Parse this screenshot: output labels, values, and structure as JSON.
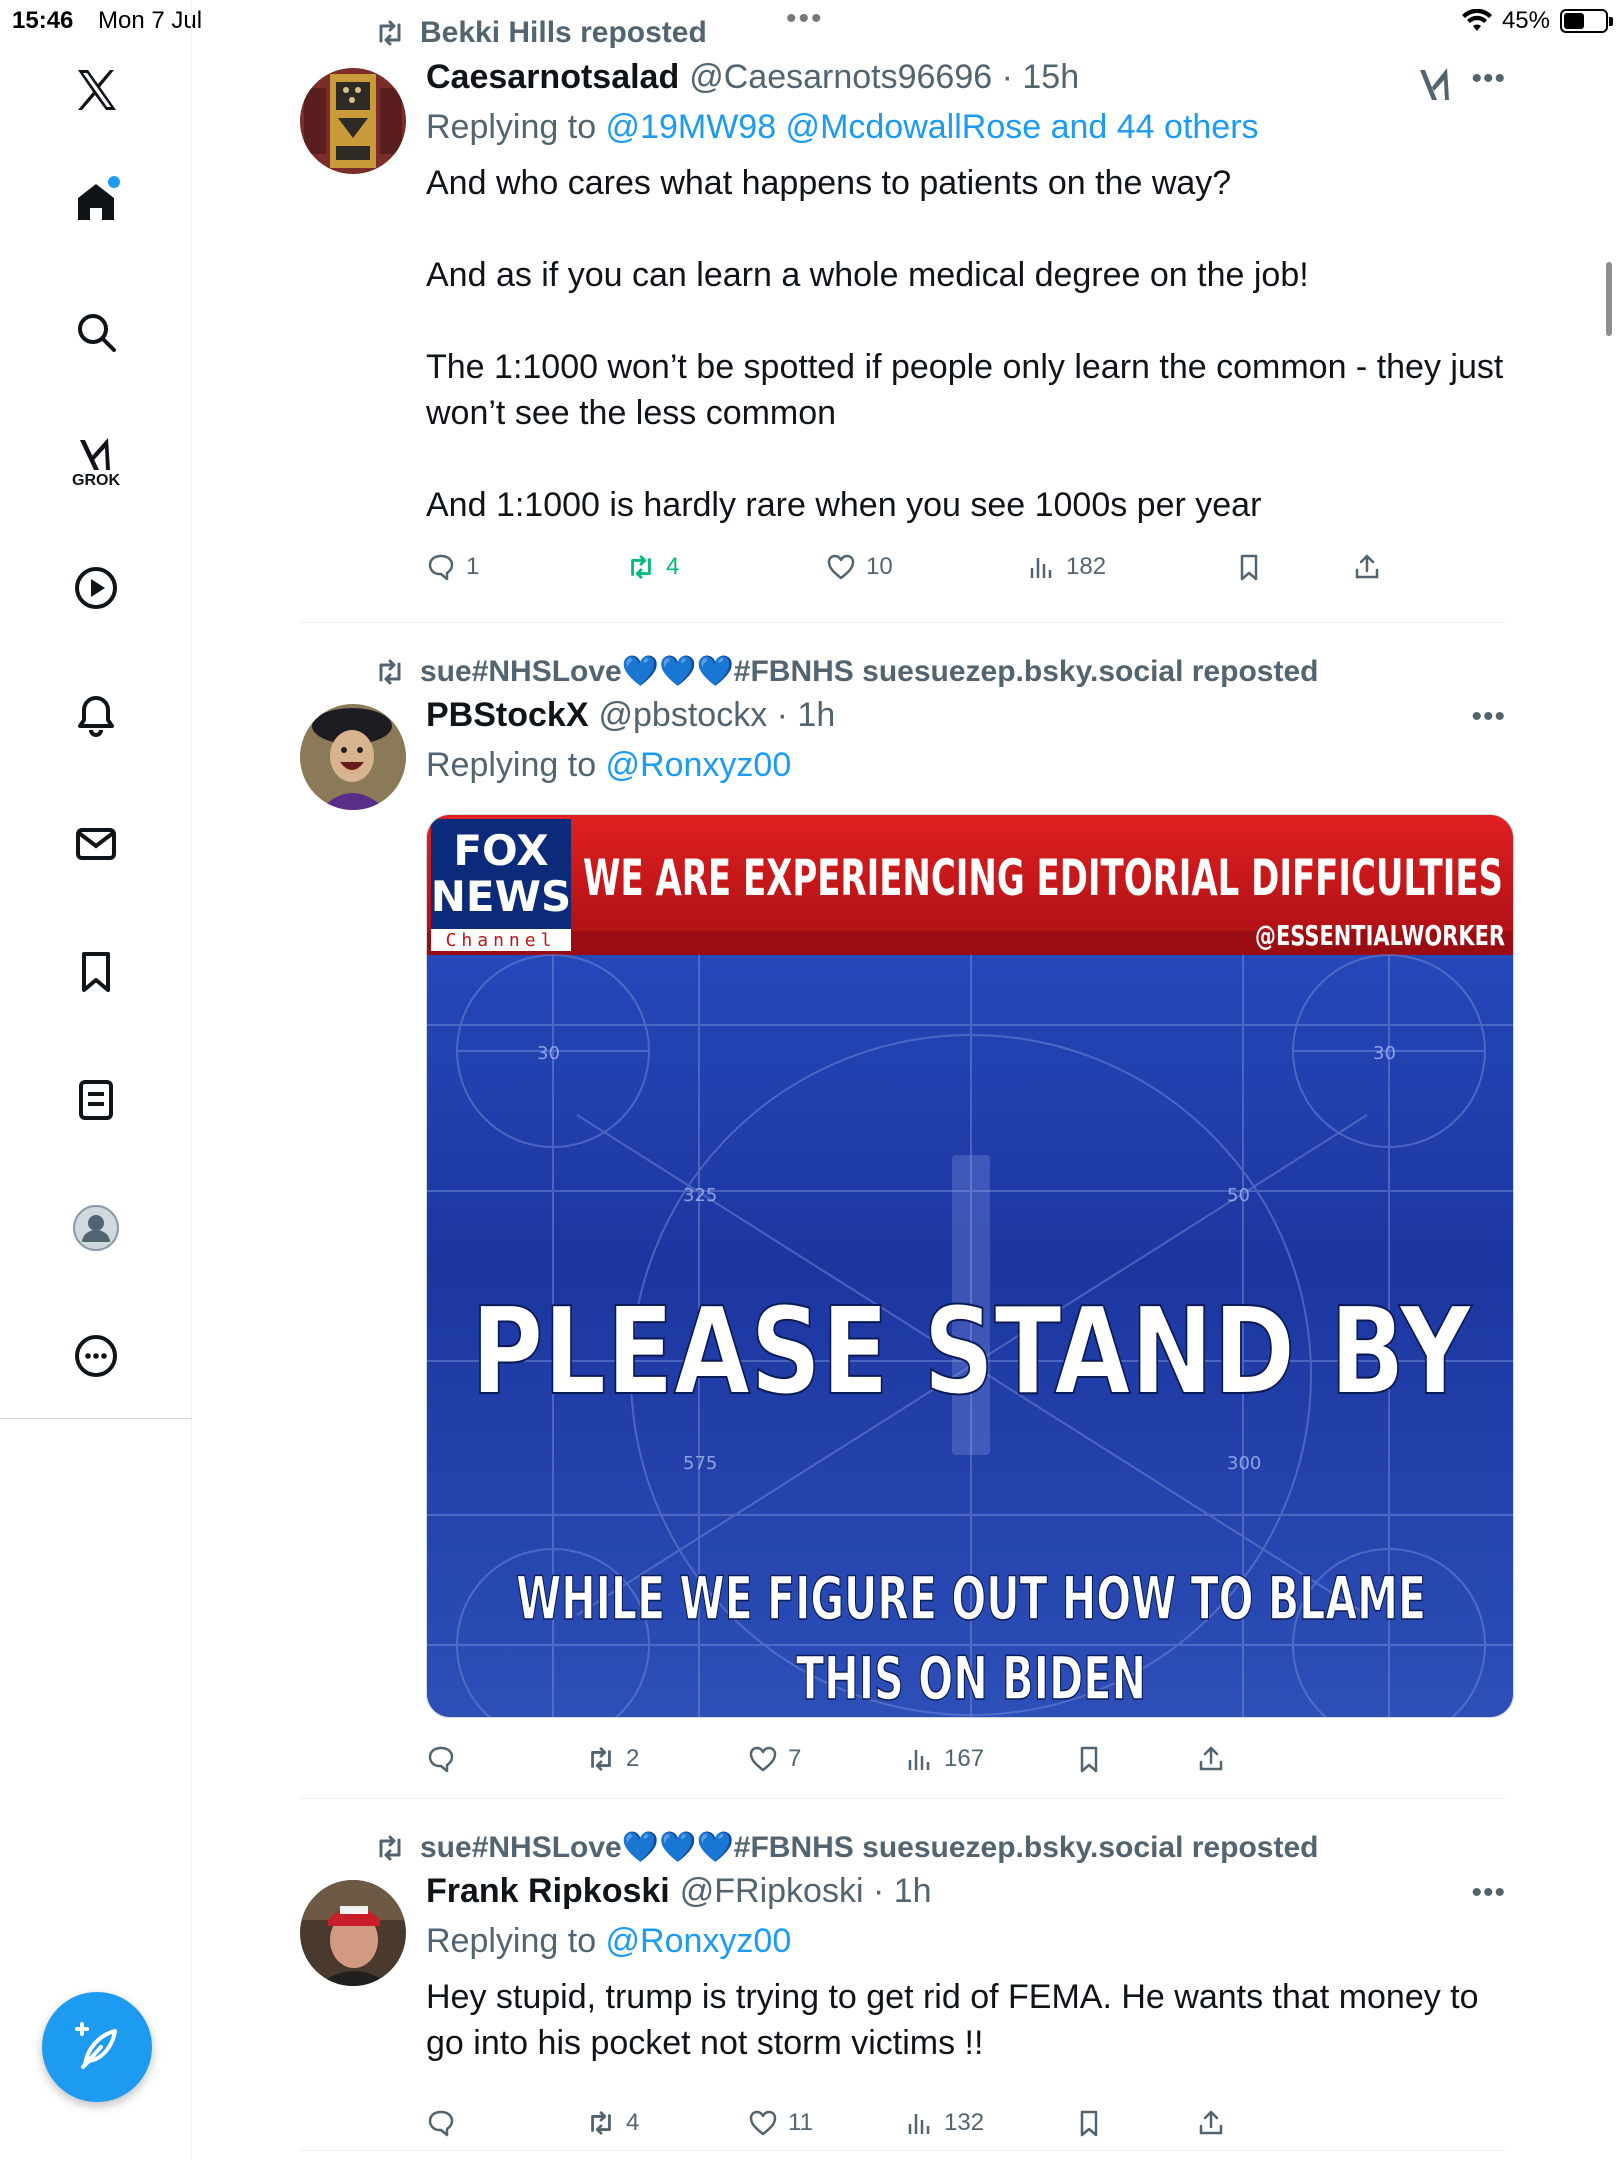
{
  "status_bar": {
    "time": "15:46",
    "date": "Mon 7 Jul",
    "battery": "45%"
  },
  "sidebar": {
    "items": [
      {
        "name": "x-logo"
      },
      {
        "name": "home"
      },
      {
        "name": "explore"
      },
      {
        "name": "grok",
        "label": "GROK"
      },
      {
        "name": "video"
      },
      {
        "name": "notifications"
      },
      {
        "name": "messages"
      },
      {
        "name": "bookmarks"
      },
      {
        "name": "lists"
      },
      {
        "name": "profile"
      },
      {
        "name": "more"
      }
    ]
  },
  "tweets": [
    {
      "reposted_by": "Bekki Hills reposted",
      "name": "Caesarnotsalad",
      "handle": "@Caesarnots96696 · 15h",
      "replying_prefix": "Replying to ",
      "replying_to": "@19MW98 @McdowallRose and 44 others",
      "text": "And who cares what happens to patients on the way?\n\nAnd as if you can learn a whole medical degree on the job!\n\nThe 1:1000 won’t be spotted if people only learn the common - they just won’t see the less common\n\nAnd 1:1000 is hardly rare when you see 1000s per year",
      "replies": "1",
      "reposts": "4",
      "likes": "10",
      "views": "182"
    },
    {
      "reposted_by": "sue#NHSLove💙💙💙#FBNHS suesuezep.bsky.social reposted",
      "name": "PBStockX",
      "handle": "@pbstockx · 1h",
      "replying_prefix": "Replying to ",
      "replying_to": "@Ronxyz00",
      "media": {
        "logo_top": "FOX",
        "logo_bottom": "NEWS",
        "logo_channel": "Channel",
        "banner": "WE ARE EXPERIENCING EDITORIAL DIFFICULTIES",
        "credit": "@ESSENTIALWORKER",
        "headline": "PLEASE STAND BY",
        "caption_line1": "WHILE WE FIGURE OUT HOW TO BLAME",
        "caption_line2": "THIS ON BIDEN",
        "card_numbers": [
          "325",
          "50",
          "575",
          "300",
          "30",
          "30"
        ]
      },
      "replies": "",
      "reposts": "2",
      "likes": "7",
      "views": "167"
    },
    {
      "reposted_by": "sue#NHSLove💙💙💙#FBNHS suesuezep.bsky.social reposted",
      "name": "Frank Ripkoski",
      "handle": "@FRipkoski · 1h",
      "replying_prefix": "Replying to ",
      "replying_to": "@Ronxyz00",
      "text": "Hey stupid, trump is trying to get rid of FEMA. He wants that money to go into his pocket not storm victims !!",
      "replies": "",
      "reposts": "4",
      "likes": "11",
      "views": "132"
    }
  ],
  "colors": {
    "accent": "#1d9bf0",
    "repost_green": "#00ba7c",
    "muted": "#536471",
    "fox_red": "#d0121c",
    "card_blue": "#1f3fa8"
  }
}
